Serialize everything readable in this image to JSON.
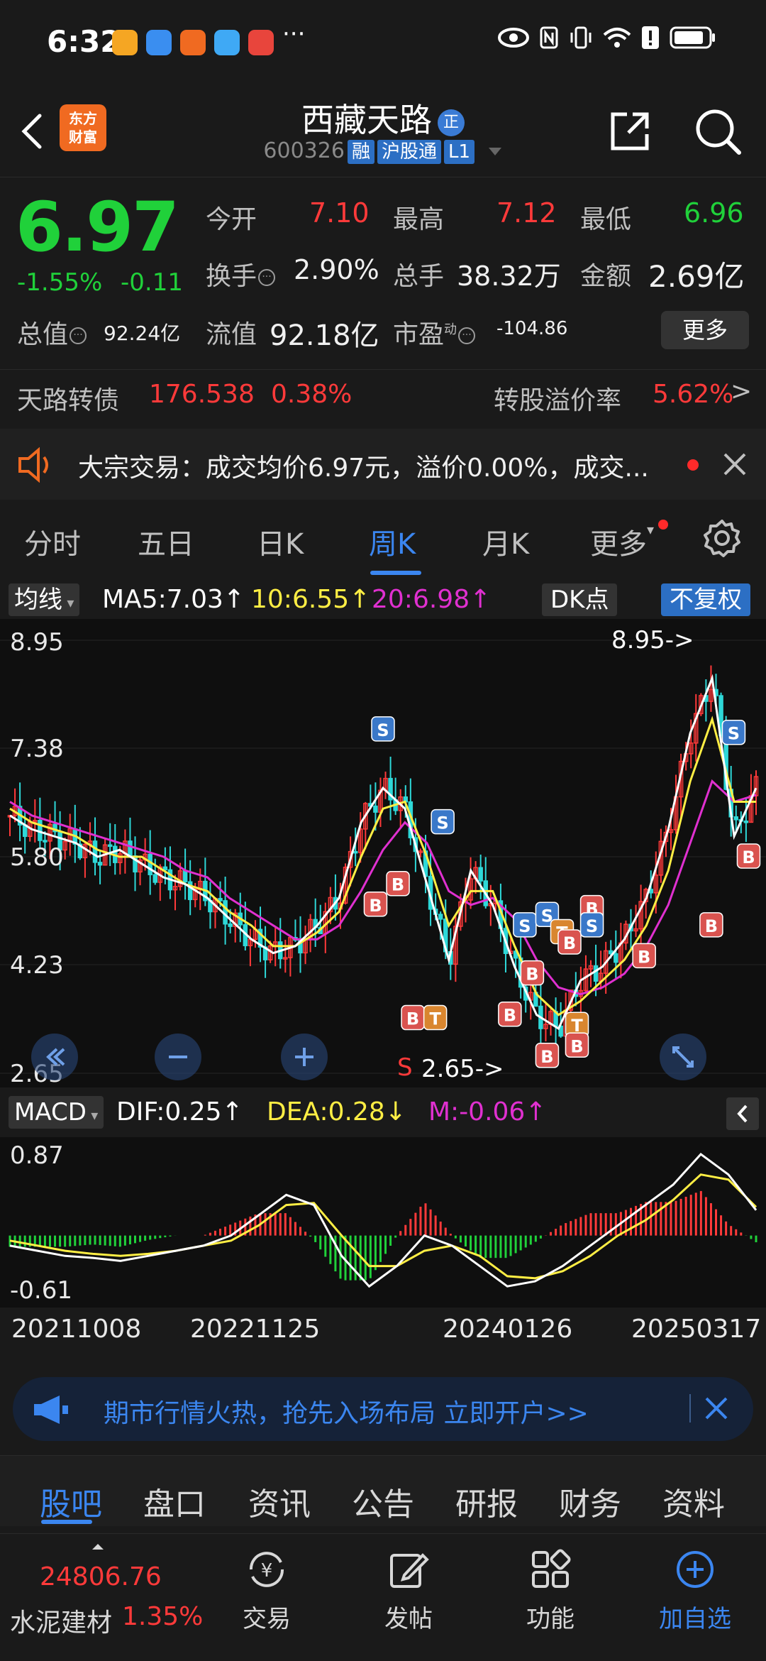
{
  "status_bar": {
    "time": "6:32",
    "more": "···"
  },
  "header": {
    "brand_label": "东方\n财富",
    "stock_name": "西藏天路",
    "zheng_badge": "正",
    "stock_code": "600326",
    "tags": [
      "融",
      "沪股通",
      "L1"
    ]
  },
  "quote": {
    "price": "6.97",
    "change_pct": "-1.55%",
    "change_amt": "-0.11",
    "open_label": "今开",
    "open": "7.10",
    "high_label": "最高",
    "high": "7.12",
    "low_label": "最低",
    "low": "6.96",
    "turnover_label": "换手",
    "turnover": "2.90%",
    "volume_label": "总手",
    "volume": "38.32万",
    "amount_label": "金额",
    "amount": "2.69亿",
    "total_value_label": "总值",
    "total_value": "92.24亿",
    "float_value_label": "流值",
    "float_value": "92.18亿",
    "pe_label": "市盈",
    "pe_sup": "动",
    "pe": "-104.86",
    "more_button": "更多"
  },
  "bond": {
    "label": "天路转债",
    "value": "176.538",
    "pct": "0.38%",
    "premium_label": "转股溢价率",
    "premium_value": "5.62%",
    "arrow": ">"
  },
  "notice": {
    "text": "大宗交易：成交均价6.97元，溢价0.00%，成交..."
  },
  "chart_tabs": [
    "分时",
    "五日",
    "日K",
    "周K",
    "月K",
    "更多"
  ],
  "active_chart_tab": "周K",
  "ma_bar": {
    "select": "均线",
    "ma5": "MA5:7.03↑",
    "ma10": "10:6.55↑",
    "ma20": "20:6.98↑",
    "dk_button": "DK点",
    "fq_button": "不复权"
  },
  "kchart": {
    "y_ticks": [
      "8.95",
      "7.38",
      "5.80",
      "4.23",
      "2.65"
    ],
    "max_label": "8.95->",
    "min_label": "2.65->",
    "overlay_s": "S"
  },
  "macd_bar": {
    "select": "MACD",
    "dif": "DIF:0.25↑",
    "dea": "DEA:0.28↓",
    "m": "M:-0.06↑"
  },
  "macd_chart": {
    "y_ticks": [
      "0.87",
      "-0.61"
    ]
  },
  "date_axis": [
    "20211008",
    "20221125",
    "20240126",
    "20250317"
  ],
  "ad": {
    "text": "期市行情火热，抢先入场布局 立即开户>>"
  },
  "sub_tabs": [
    "股吧",
    "盘口",
    "资讯",
    "公告",
    "研报",
    "财务",
    "资料"
  ],
  "active_sub_tab": "股吧",
  "bottom_bar": {
    "index_value": "24806.76",
    "index_name": "水泥建材",
    "index_change": "1.35%",
    "nav": [
      "交易",
      "发帖",
      "功能",
      "加自选"
    ]
  },
  "colors": {
    "up": "#ff3a3a",
    "down": "#20d13a",
    "accent": "#3b86f0",
    "ma5": "#ffffff",
    "ma10": "#ffee44",
    "ma20": "#e030d0"
  },
  "chart_data": {
    "type": "candlestick",
    "y_range": [
      2.65,
      8.95
    ],
    "ma_lines": {
      "ma5": [
        6.4,
        6.2,
        6.1,
        6.0,
        5.8,
        5.9,
        5.7,
        5.5,
        5.4,
        5.2,
        4.9,
        4.6,
        4.4,
        4.5,
        4.8,
        5.2,
        6.3,
        6.8,
        6.5,
        5.4,
        4.3,
        5.6,
        5.1,
        4.2,
        3.5,
        3.3,
        4.0,
        4.2,
        4.6,
        5.2,
        6.2,
        7.6,
        8.4,
        6.1,
        6.8
      ],
      "ma10": [
        6.5,
        6.3,
        6.2,
        6.1,
        5.9,
        5.8,
        5.8,
        5.6,
        5.4,
        5.3,
        5.0,
        4.8,
        4.5,
        4.5,
        4.7,
        5.0,
        5.8,
        6.5,
        6.6,
        5.8,
        4.8,
        5.3,
        5.3,
        4.5,
        3.8,
        3.5,
        3.7,
        4.0,
        4.3,
        4.8,
        5.6,
        6.9,
        7.8,
        6.6,
        6.6
      ],
      "ma20": [
        6.6,
        6.4,
        6.3,
        6.2,
        6.1,
        6.0,
        5.9,
        5.8,
        5.6,
        5.5,
        5.2,
        5.0,
        4.8,
        4.6,
        4.6,
        4.8,
        5.3,
        5.9,
        6.3,
        6.0,
        5.3,
        5.1,
        5.2,
        4.9,
        4.3,
        3.9,
        3.8,
        3.9,
        4.1,
        4.5,
        5.1,
        6.0,
        6.9,
        6.6,
        6.7
      ]
    },
    "macd": {
      "dif": [
        -0.1,
        -0.15,
        -0.2,
        -0.22,
        -0.25,
        -0.2,
        -0.15,
        -0.1,
        0.0,
        0.2,
        0.4,
        0.3,
        -0.2,
        -0.5,
        -0.3,
        0.0,
        -0.1,
        -0.3,
        -0.5,
        -0.45,
        -0.3,
        -0.1,
        0.1,
        0.3,
        0.5,
        0.8,
        0.6,
        0.25
      ],
      "dea": [
        -0.05,
        -0.1,
        -0.15,
        -0.18,
        -0.2,
        -0.18,
        -0.15,
        -0.1,
        -0.05,
        0.1,
        0.3,
        0.32,
        0.0,
        -0.3,
        -0.3,
        -0.15,
        -0.1,
        -0.2,
        -0.4,
        -0.42,
        -0.35,
        -0.2,
        0.0,
        0.15,
        0.35,
        0.6,
        0.55,
        0.28
      ]
    }
  }
}
